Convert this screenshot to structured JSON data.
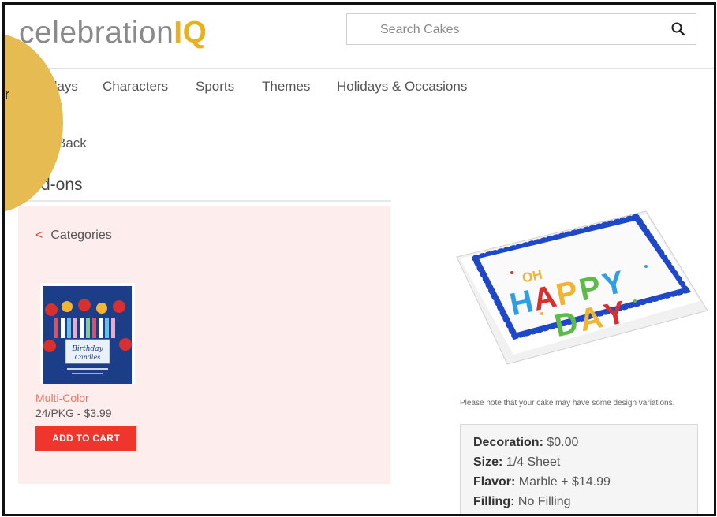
{
  "header": {
    "logo_text_main": "celebration",
    "logo_text_accent": "IQ",
    "search_placeholder": "Search Cakes"
  },
  "nav": {
    "items": [
      "days",
      "Characters",
      "Sports",
      "Themes",
      "Holidays & Occasions"
    ]
  },
  "back_label": "Back",
  "section_title": "d-ons",
  "overlay_text": "r",
  "categories_label": "Categories",
  "product": {
    "name": "Multi-Color",
    "price": "24/PKG - $3.99",
    "add_to_cart_label": "ADD TO CART"
  },
  "cake_note": "Please note that your cake may have some design variations.",
  "details": {
    "decoration_label": "Decoration:",
    "decoration_value": "$0.00",
    "size_label": "Size:",
    "size_value": "1/4 Sheet",
    "flavor_label": "Flavor:",
    "flavor_value": "Marble + $14.99",
    "filling_label": "Filling:",
    "filling_value": "No Filling"
  },
  "colors": {
    "brand_gold": "#e9b21a",
    "cart_red": "#f0352c",
    "panel_pink": "#fdeeed",
    "product_name_coral": "#f07569"
  }
}
